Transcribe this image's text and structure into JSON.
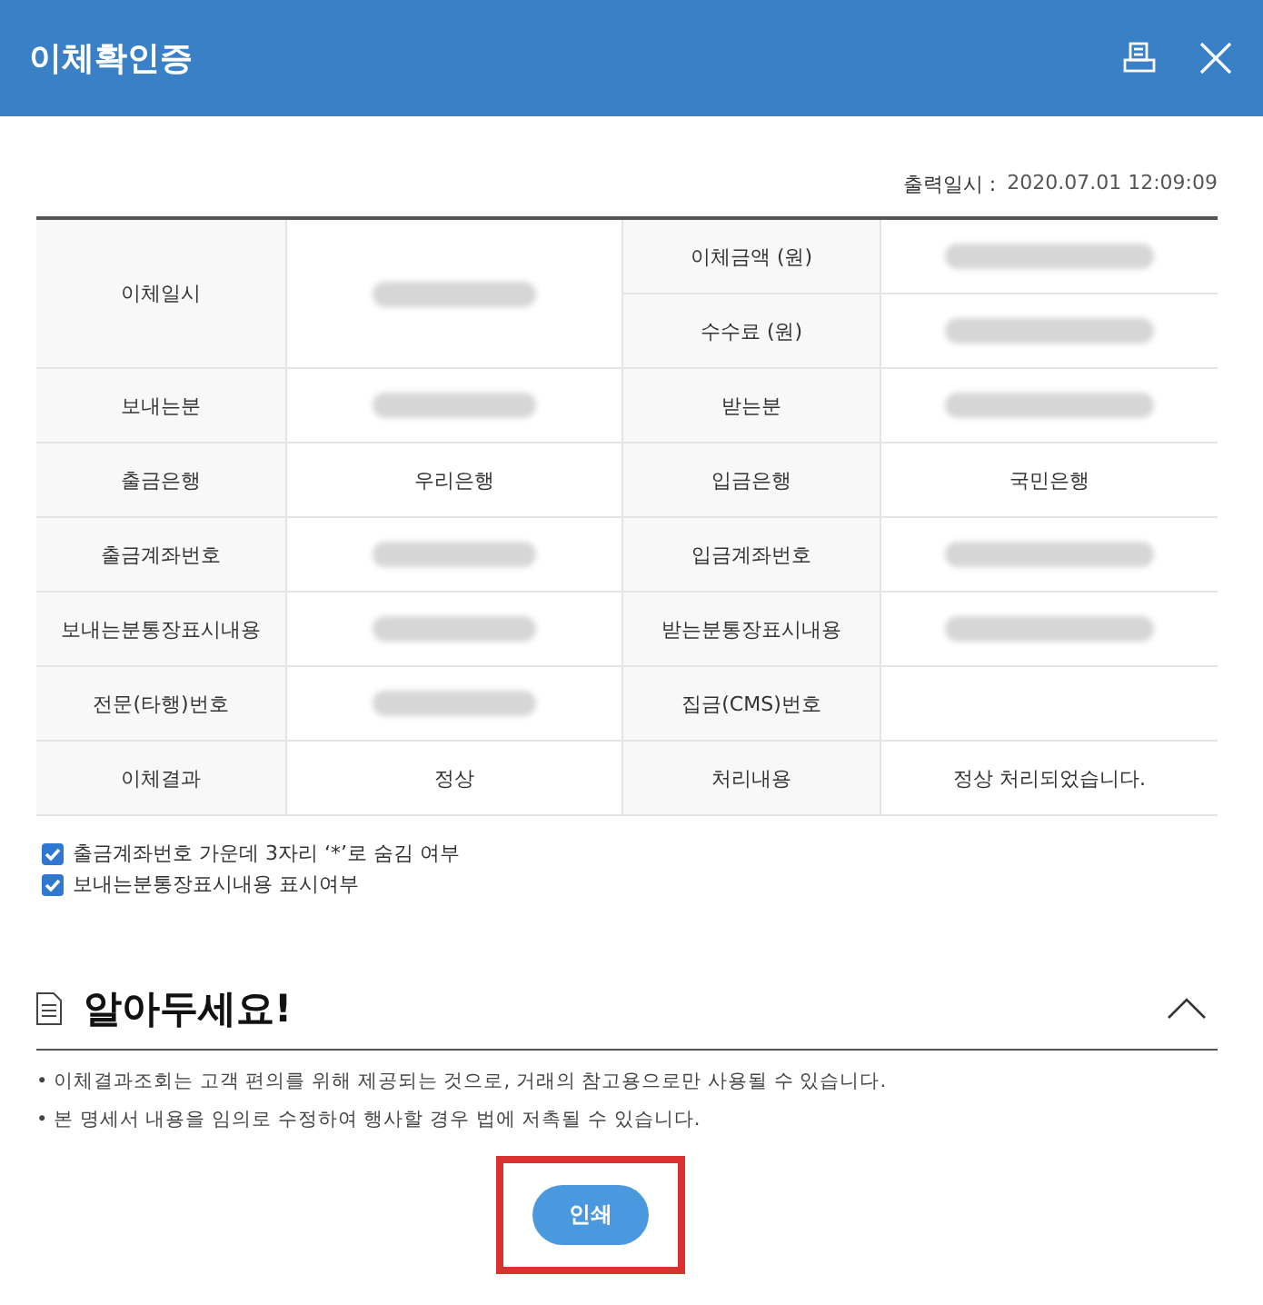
{
  "window": {
    "title": "이체확인증"
  },
  "printed_at": {
    "label": "출력일시 :",
    "value": "2020.07.01 12:09:09"
  },
  "table": {
    "rows": [
      {
        "label": "이체일시",
        "redacted": true,
        "right": [
          {
            "label": "이체금액 (원)",
            "redacted": true
          },
          {
            "label": "수수료 (원)",
            "redacted": true
          }
        ]
      },
      {
        "label": "보내는분",
        "redacted": true,
        "right": [
          {
            "label": "받는분",
            "redacted": true
          }
        ]
      },
      {
        "label": "출금은행",
        "value": "우리은행",
        "right": [
          {
            "label": "입금은행",
            "value": "국민은행"
          }
        ]
      },
      {
        "label": "출금계좌번호",
        "redacted": true,
        "right": [
          {
            "label": "입금계좌번호",
            "redacted": true
          }
        ]
      },
      {
        "label": "보내는분통장표시내용",
        "redacted": true,
        "right": [
          {
            "label": "받는분통장표시내용",
            "redacted": true
          }
        ]
      },
      {
        "label": "전문(타행)번호",
        "redacted": true,
        "right": [
          {
            "label": "집금(CMS)번호"
          }
        ]
      },
      {
        "label": "이체결과",
        "value": "정상",
        "right": [
          {
            "label": "처리내용",
            "value": "정상 처리되었습니다."
          }
        ]
      }
    ]
  },
  "options": [
    {
      "label": "출금계좌번호 가운데 3자리 ‘*’로 숨김 여부",
      "checked": true
    },
    {
      "label": "보내는분통장표시내용 표시여부",
      "checked": true
    }
  ],
  "notice": {
    "title": "알아두세요!",
    "expanded": true,
    "items": [
      "• 이체결과조회는 고객 편의를 위해 제공되는 것으로, 거래의 참고용으로만 사용될 수 있습니다.",
      "• 본 명세서 내용을 임의로 수정하여 행사할 경우 법에 저촉될 수 있습니다."
    ]
  },
  "print_button": {
    "label": "인쇄",
    "highlighted": true
  }
}
